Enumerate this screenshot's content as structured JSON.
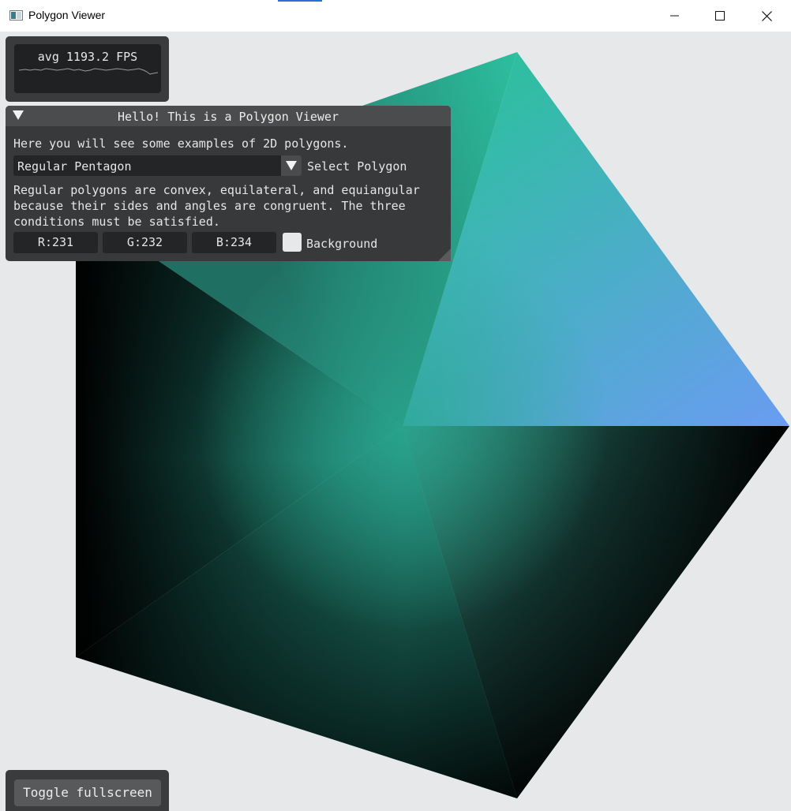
{
  "window": {
    "title": "Polygon Viewer",
    "minimize_icon": "minimize-icon",
    "maximize_icon": "maximize-icon",
    "close_icon": "close-icon"
  },
  "fps_overlay": {
    "label": "avg 1193.2 FPS"
  },
  "polygon_panel": {
    "title": "Hello! This is a Polygon Viewer",
    "intro": "Here you will see some examples of 2D polygons.",
    "select": {
      "value": "Regular Pentagon",
      "label": "Select Polygon"
    },
    "description_lines": [
      "Regular polygons are convex, equilateral, and equiangular",
      "because their sides and angles are congruent. The three",
      "conditions must be satisfied."
    ],
    "color": {
      "r": "R:231",
      "g": "G:232",
      "b": "B:234",
      "label": "Background",
      "swatch": "#e7e8ea"
    }
  },
  "fullscreen_panel": {
    "button_label": "Toggle fullscreen"
  },
  "scene": {
    "shape": "Regular Pentagon",
    "background": "#e7e8ea",
    "colors": {
      "top": "#2dbe9f",
      "right": "#6699f0",
      "center": "#2aa890",
      "dark": "#000000"
    }
  }
}
